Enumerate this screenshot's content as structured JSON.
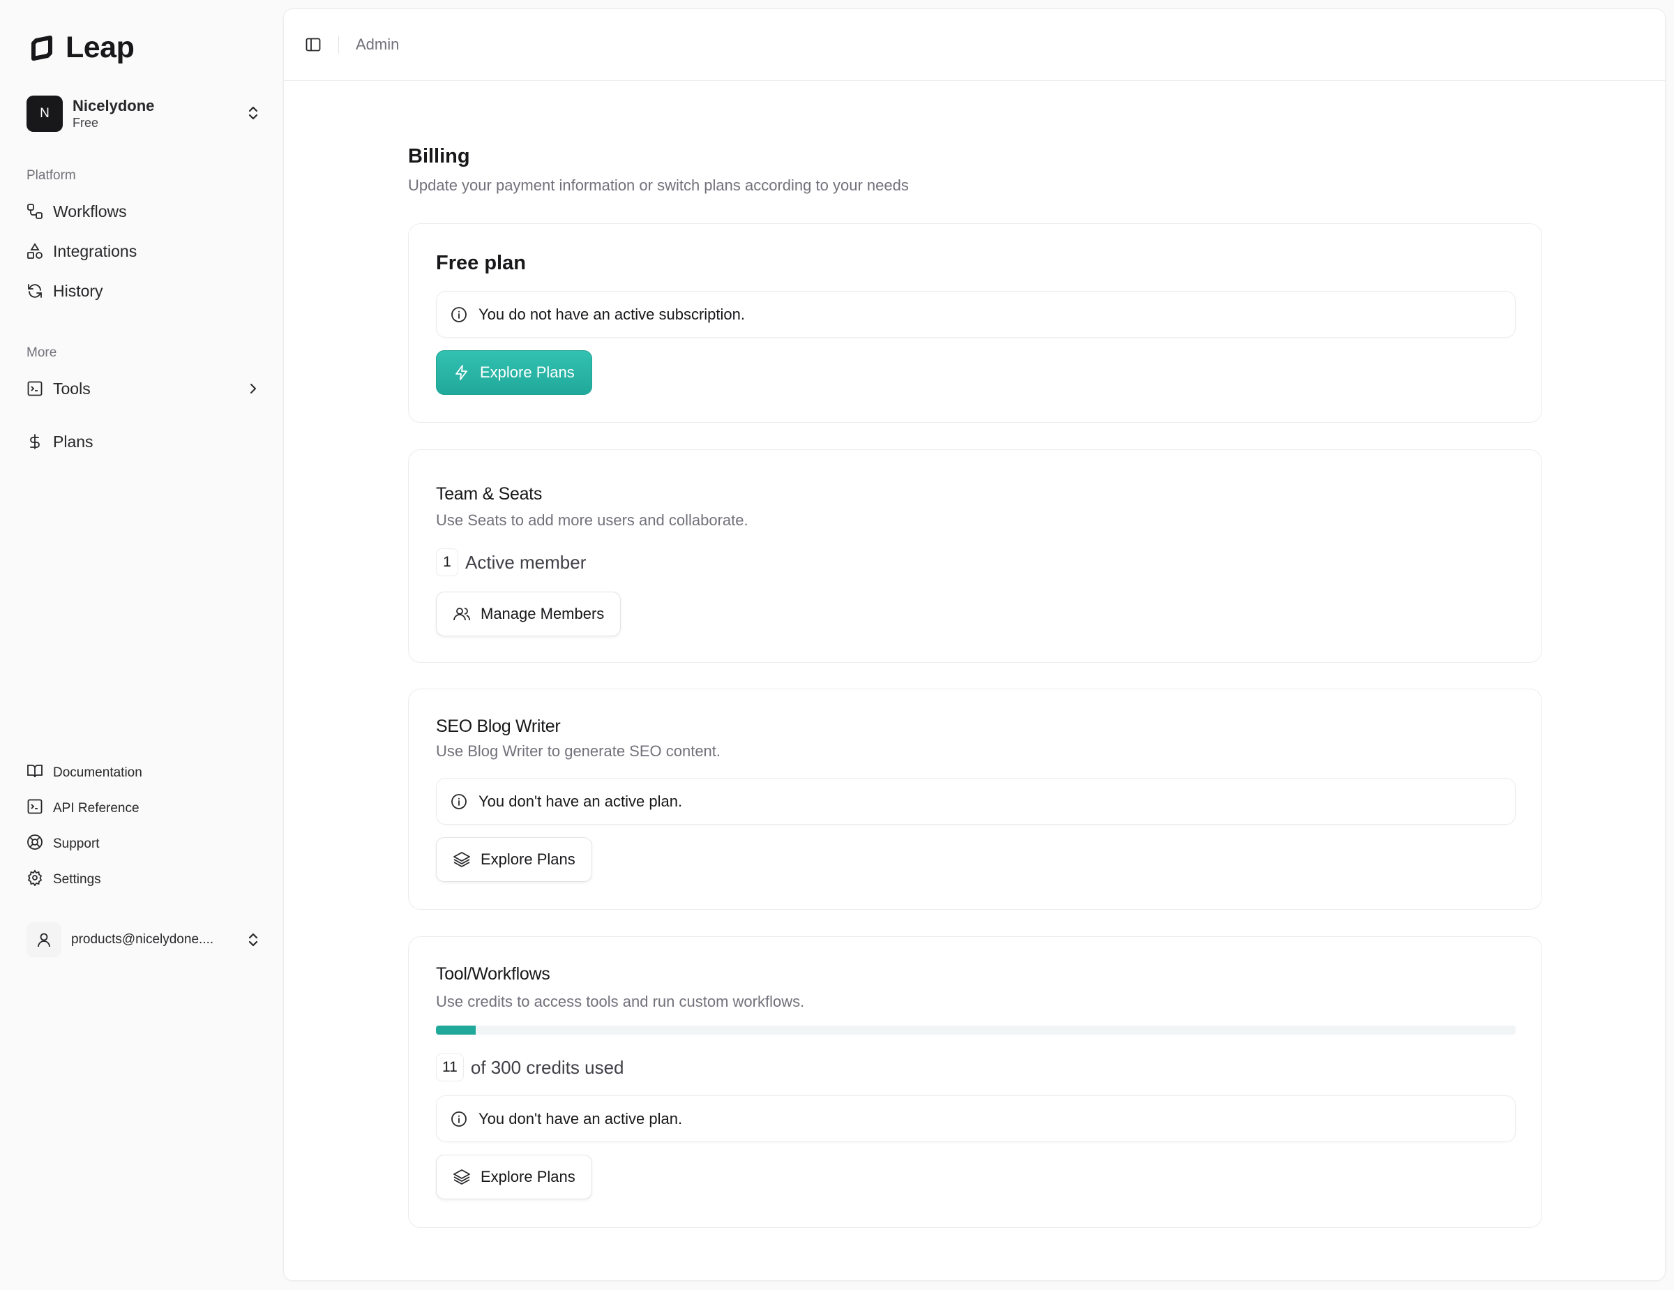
{
  "app": {
    "name": "Leap"
  },
  "org": {
    "initial": "N",
    "name": "Nicelydone",
    "plan": "Free"
  },
  "sidebar": {
    "platform_label": "Platform",
    "platform_items": [
      {
        "label": "Workflows",
        "icon": "workflow-icon"
      },
      {
        "label": "Integrations",
        "icon": "shapes-icon"
      },
      {
        "label": "History",
        "icon": "refresh-icon"
      }
    ],
    "more_label": "More",
    "more_items": [
      {
        "label": "Tools",
        "icon": "terminal-icon"
      },
      {
        "label": "Plans",
        "icon": "dollar-icon"
      }
    ],
    "footer_items": [
      {
        "label": "Documentation",
        "icon": "book-icon"
      },
      {
        "label": "API Reference",
        "icon": "terminal-icon"
      },
      {
        "label": "Support",
        "icon": "lifebuoy-icon"
      },
      {
        "label": "Settings",
        "icon": "gear-icon"
      }
    ],
    "user_email": "products@nicelydone...."
  },
  "header": {
    "breadcrumb": "Admin"
  },
  "billing": {
    "title": "Billing",
    "subtitle": "Update your payment information or switch plans according to your needs",
    "free_plan": {
      "title": "Free plan",
      "alert": "You do not have an active subscription.",
      "button": "Explore Plans"
    },
    "team": {
      "title": "Team & Seats",
      "desc": "Use Seats to add more users and collaborate.",
      "count": "1",
      "count_label": "Active member",
      "button": "Manage Members"
    },
    "seo": {
      "title": "SEO Blog Writer",
      "desc": "Use Blog Writer to generate SEO content.",
      "alert": "You don't have an active plan.",
      "button": "Explore Plans"
    },
    "tools": {
      "title": "Tool/Workflows",
      "desc": "Use credits to access tools and run custom workflows.",
      "used": "11",
      "used_label": "of 300 credits used",
      "progress_fraction": 0.0367,
      "alert": "You don't have an active plan.",
      "button": "Explore Plans"
    }
  },
  "colors": {
    "accent": "#20a99a",
    "text": "#18181b",
    "muted": "#71717a"
  }
}
